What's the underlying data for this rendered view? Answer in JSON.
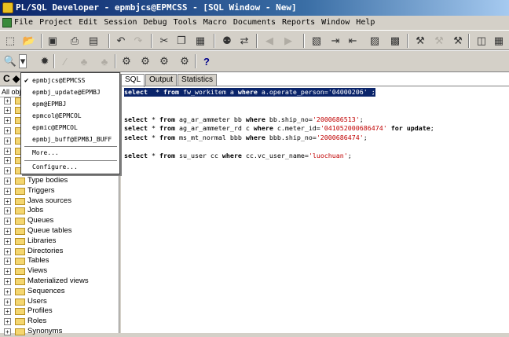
{
  "window": {
    "title": "PL/SQL Developer - epmbjcs@EPMCSS - [SQL Window - New]"
  },
  "menu": [
    "File",
    "Project",
    "Edit",
    "Session",
    "Debug",
    "Tools",
    "Macro",
    "Documents",
    "Reports",
    "Window",
    "Help"
  ],
  "toolbar1": {
    "icons": [
      "new-icon",
      "open-icon",
      "save-icon",
      "print-icon",
      "print-preview-icon",
      "undo-icon",
      "redo-icon",
      "cut-icon",
      "copy-icon",
      "paste-icon",
      "find-icon",
      "replace-icon",
      "back-icon",
      "forward-icon",
      "compile-icon",
      "indent-icon",
      "unindent-icon",
      "comment-icon",
      "uncomment-icon",
      "tool1-icon",
      "tool2-icon",
      "tool3-icon",
      "window1-icon",
      "window2-icon"
    ]
  },
  "toolbar2": {
    "icons": [
      "key-icon",
      "dropdown-arrow-icon",
      "object-icon",
      "rollback-icon",
      "commit-icon",
      "stop-icon",
      "db-icon1",
      "db-icon2",
      "db-icon3",
      "db-icon4",
      "help-icon"
    ],
    "help_label": "?"
  },
  "leftpanel": {
    "header": "C ◆",
    "filter": "All obj"
  },
  "connections_dropdown": {
    "items": [
      {
        "label": "epmbjcs@EPMCSS",
        "checked": true
      },
      {
        "label": "epmbj_update@EPMBJ",
        "checked": false
      },
      {
        "label": "epm@EPMBJ",
        "checked": false
      },
      {
        "label": "epmcol@EPMCOL",
        "checked": false
      },
      {
        "label": "epmic@EPMCOL",
        "checked": false
      },
      {
        "label": "epmbj_buff@EPMBJ_BUFF",
        "checked": false
      }
    ],
    "more": "More...",
    "configure": "Configure...",
    "check_mark": "✔"
  },
  "tree": [
    "Type bodies",
    "Triggers",
    "Java sources",
    "Jobs",
    "Queues",
    "Queue tables",
    "Libraries",
    "Directories",
    "Tables",
    "Views",
    "Materialized views",
    "Sequences",
    "Users",
    "Profiles",
    "Roles",
    "Synonyms"
  ],
  "editor": {
    "tabs": [
      "SQL",
      "Output",
      "Statistics"
    ],
    "lines": [
      {
        "parts": [
          [
            "kw",
            "select"
          ],
          [
            "",
            "  * "
          ],
          [
            "kw",
            "from"
          ],
          [
            "",
            " fw_workitem a "
          ],
          [
            "kw",
            "where"
          ],
          [
            "",
            " a.operate_person="
          ],
          [
            "str",
            "'04000206'"
          ],
          [
            "",
            " ;"
          ]
        ],
        "selected": true
      },
      {
        "parts": [],
        "selected": false
      },
      {
        "parts": [],
        "selected": false
      },
      {
        "parts": [
          [
            "kw",
            "select"
          ],
          [
            "",
            " * "
          ],
          [
            "kw",
            "from"
          ],
          [
            "",
            " ag_ar_ammeter bb "
          ],
          [
            "kw",
            "where"
          ],
          [
            "",
            " bb.ship_no="
          ],
          [
            "str",
            "'2000686513'"
          ],
          [
            "",
            ";"
          ]
        ],
        "selected": false
      },
      {
        "parts": [
          [
            "kw",
            "select"
          ],
          [
            "",
            " * "
          ],
          [
            "kw",
            "from"
          ],
          [
            "",
            " ag_ar_ammeter_rd c "
          ],
          [
            "kw",
            "where"
          ],
          [
            "",
            " c.meter_id="
          ],
          [
            "str",
            "'041052000686474'"
          ],
          [
            "",
            " "
          ],
          [
            "kw",
            "for update"
          ],
          [
            "",
            ";"
          ]
        ],
        "selected": false
      },
      {
        "parts": [
          [
            "kw",
            "select"
          ],
          [
            "",
            " * "
          ],
          [
            "kw",
            "from"
          ],
          [
            "",
            " ms_mt_normal bbb "
          ],
          [
            "kw",
            "where"
          ],
          [
            "",
            " bbb.ship_no="
          ],
          [
            "str",
            "'2000686474'"
          ],
          [
            "",
            ";"
          ]
        ],
        "selected": false
      },
      {
        "parts": [],
        "selected": false
      },
      {
        "parts": [
          [
            "kw",
            "select"
          ],
          [
            "",
            " * "
          ],
          [
            "kw",
            "from"
          ],
          [
            "",
            " su_user cc "
          ],
          [
            "kw",
            "where"
          ],
          [
            "",
            " cc.vc_user_name="
          ],
          [
            "str",
            "'luochuan'"
          ],
          [
            "",
            ";"
          ]
        ],
        "selected": false
      }
    ]
  }
}
